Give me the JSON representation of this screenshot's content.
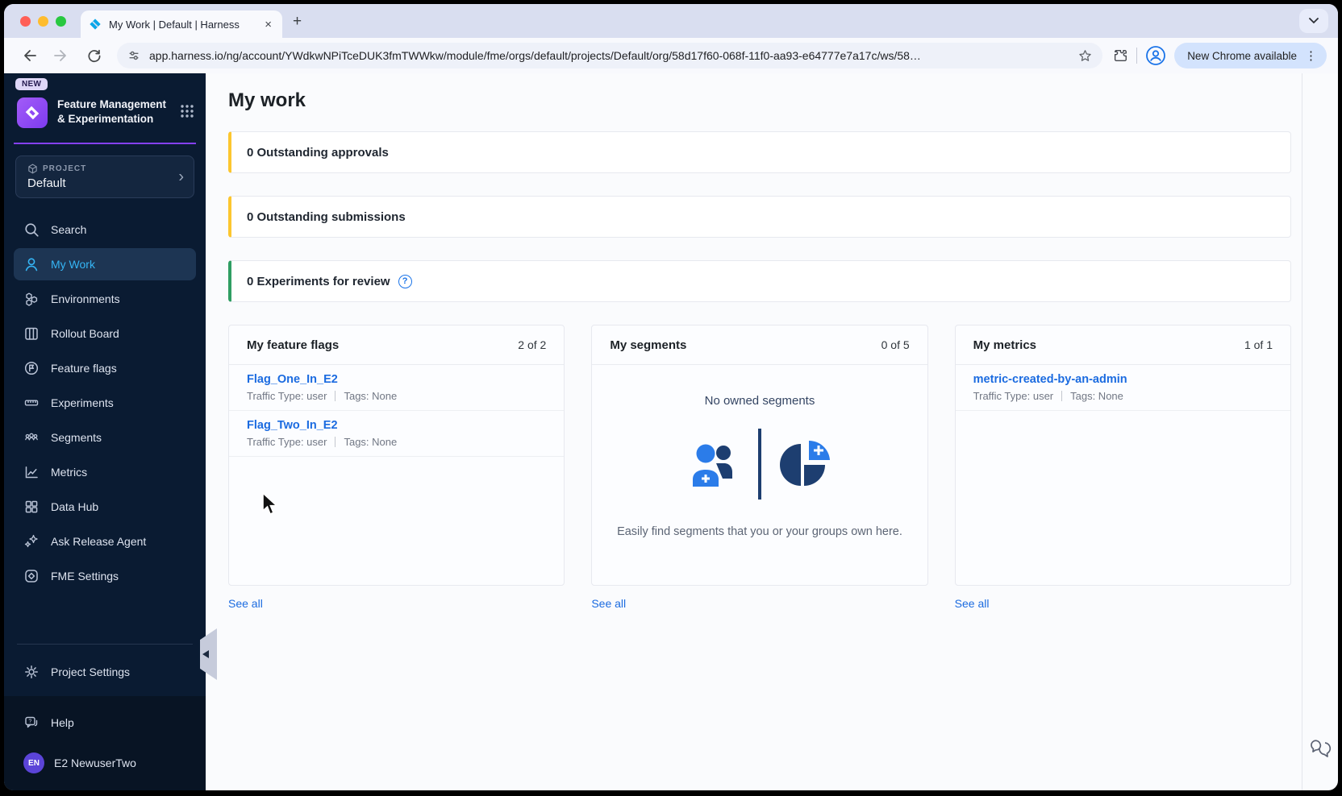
{
  "browser": {
    "tab_title": "My Work | Default | Harness",
    "close_glyph": "×",
    "newtab_glyph": "+",
    "url": "app.harness.io/ng/account/YWdkwNPiTceDUK3fmTWWkw/module/fme/orgs/default/projects/Default/org/58d17f60-068f-11f0-aa93-e64777e7a17c/ws/58…",
    "new_chrome_label": "New Chrome available",
    "menu_dots": "⋮"
  },
  "sidebar": {
    "badge_new": "NEW",
    "module_title": "Feature Management & Experimentation",
    "project_label": "PROJECT",
    "project_name": "Default",
    "project_chevron": "›",
    "items": [
      {
        "label": "Search"
      },
      {
        "label": "My Work"
      },
      {
        "label": "Environments"
      },
      {
        "label": "Rollout Board"
      },
      {
        "label": "Feature flags"
      },
      {
        "label": "Experiments"
      },
      {
        "label": "Segments"
      },
      {
        "label": "Metrics"
      },
      {
        "label": "Data Hub"
      },
      {
        "label": "Ask Release Agent"
      },
      {
        "label": "FME Settings"
      }
    ],
    "settings_label": "Project Settings",
    "help_label": "Help",
    "user_initials": "EN",
    "user_name": "E2 NewuserTwo"
  },
  "main": {
    "title": "My work",
    "banners": [
      {
        "text": "0 Outstanding approvals"
      },
      {
        "text": "0 Outstanding submissions"
      },
      {
        "text": "0 Experiments for review",
        "help_glyph": "?"
      }
    ],
    "cards": {
      "flags": {
        "title": "My feature flags",
        "count": "2 of 2",
        "items": [
          {
            "name": "Flag_One_In_E2",
            "traffic": "Traffic Type: user",
            "tags": "Tags: None"
          },
          {
            "name": "Flag_Two_In_E2",
            "traffic": "Traffic Type: user",
            "tags": "Tags: None"
          }
        ],
        "see_all": "See all"
      },
      "segments": {
        "title": "My segments",
        "count": "0 of 5",
        "empty_title": "No owned segments",
        "empty_caption": "Easily find segments that you or your groups own here.",
        "see_all": "See all"
      },
      "metrics": {
        "title": "My metrics",
        "count": "1 of 1",
        "items": [
          {
            "name": "metric-created-by-an-admin",
            "traffic": "Traffic Type: user",
            "tags": "Tags: None"
          }
        ],
        "see_all": "See all"
      }
    }
  },
  "colors": {
    "sidebar_bg": "#0a1b32",
    "sidebar_active_text": "#35b5f5",
    "accent_purple": "#8540f5",
    "banner_yellow": "#fcc62f",
    "banner_green": "#2f9e63",
    "link_blue": "#1b6be0",
    "illustration_blue": "#2b7ce9",
    "illustration_navy": "#1d3e70"
  }
}
